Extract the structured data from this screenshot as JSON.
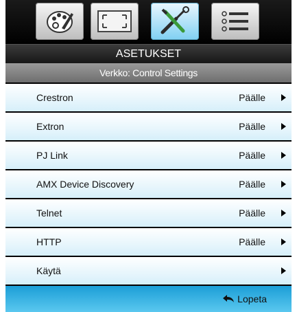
{
  "tabs": [
    {
      "name": "image-settings-icon"
    },
    {
      "name": "display-settings-icon"
    },
    {
      "name": "setup-tools-icon"
    },
    {
      "name": "options-list-icon"
    }
  ],
  "header": {
    "title": "ASETUKSET"
  },
  "subheader": {
    "title": "Verkko: Control Settings"
  },
  "menu": {
    "items": [
      {
        "label": "Crestron",
        "value": "Päälle"
      },
      {
        "label": "Extron",
        "value": "Päälle"
      },
      {
        "label": "PJ Link",
        "value": "Päälle"
      },
      {
        "label": "AMX Device Discovery",
        "value": "Päälle"
      },
      {
        "label": "Telnet",
        "value": "Päälle"
      },
      {
        "label": "HTTP",
        "value": "Päälle"
      },
      {
        "label": "Käytä",
        "value": ""
      }
    ]
  },
  "footer": {
    "exit_label": "Lopeta"
  },
  "colors": {
    "accent": "#1c9ed7",
    "row_tint": "#d6effa"
  }
}
